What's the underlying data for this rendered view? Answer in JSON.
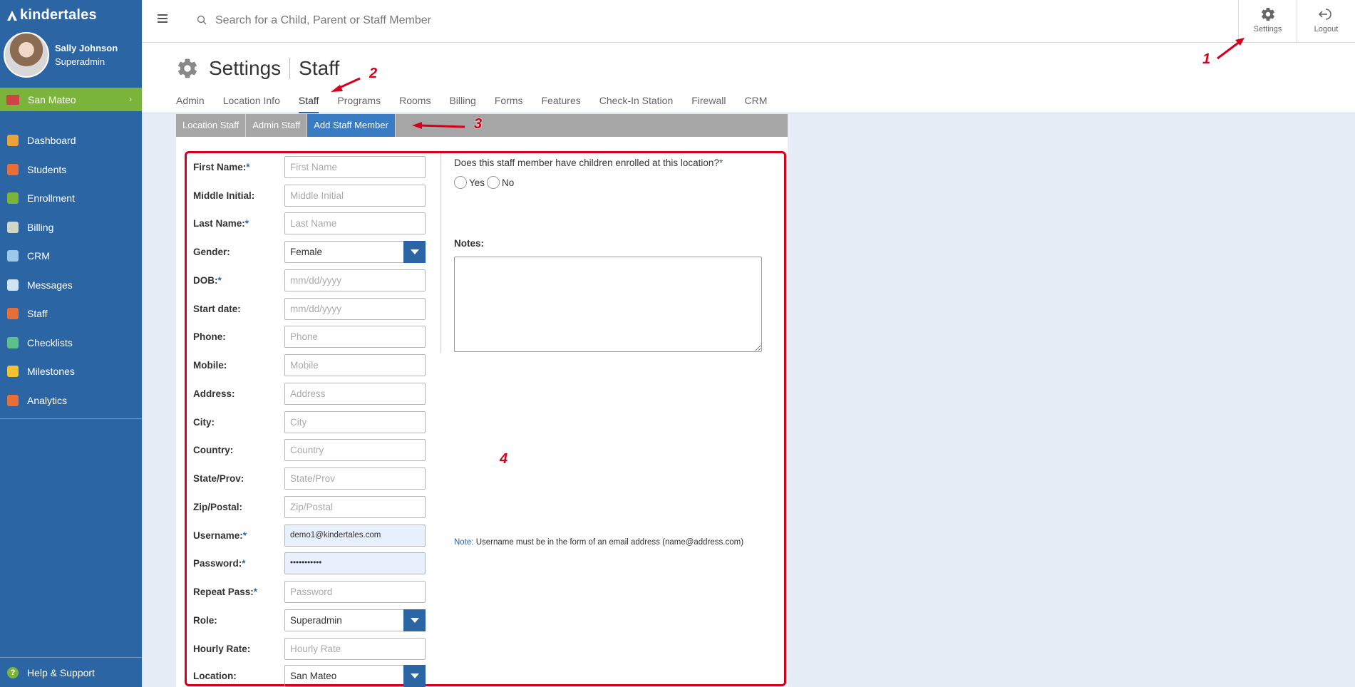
{
  "app": {
    "logo_text": "kindertales"
  },
  "profile": {
    "name": "Sally Johnson",
    "role": "Superadmin"
  },
  "location": {
    "name": "San Mateo"
  },
  "sidebar": {
    "items": [
      {
        "label": "Dashboard",
        "color": "#e8a33a"
      },
      {
        "label": "Students",
        "color": "#e76f3a"
      },
      {
        "label": "Enrollment",
        "color": "#7bb43a"
      },
      {
        "label": "Billing",
        "color": "#cfd8c4"
      },
      {
        "label": "CRM",
        "color": "#9cc8ea"
      },
      {
        "label": "Messages",
        "color": "#cfe3f5"
      },
      {
        "label": "Staff",
        "color": "#e76f3a"
      },
      {
        "label": "Checklists",
        "color": "#5fbf8a"
      },
      {
        "label": "Milestones",
        "color": "#f2c230"
      },
      {
        "label": "Analytics",
        "color": "#e76f3a"
      }
    ],
    "help_label": "Help & Support"
  },
  "topbar": {
    "search_placeholder": "Search for a Child, Parent or Staff Member",
    "settings_label": "Settings",
    "logout_label": "Logout"
  },
  "header": {
    "title": "Settings",
    "subtitle": "Staff"
  },
  "tabs": [
    "Admin",
    "Location Info",
    "Staff",
    "Programs",
    "Rooms",
    "Billing",
    "Forms",
    "Features",
    "Check-In Station",
    "Firewall",
    "CRM"
  ],
  "active_tab": "Staff",
  "subtabs": [
    "Location Staff",
    "Admin Staff",
    "Add Staff Member"
  ],
  "form": {
    "first_name": {
      "label": "First Name:",
      "placeholder": "First Name"
    },
    "middle_initial": {
      "label": "Middle Initial:",
      "placeholder": "Middle Initial"
    },
    "last_name": {
      "label": "Last Name:",
      "placeholder": "Last Name"
    },
    "gender": {
      "label": "Gender:",
      "value": "Female"
    },
    "dob": {
      "label": "DOB:",
      "placeholder": "mm/dd/yyyy"
    },
    "start_date": {
      "label": "Start date:",
      "placeholder": "mm/dd/yyyy"
    },
    "phone": {
      "label": "Phone:",
      "placeholder": "Phone"
    },
    "mobile": {
      "label": "Mobile:",
      "placeholder": "Mobile"
    },
    "address": {
      "label": "Address:",
      "placeholder": "Address"
    },
    "city": {
      "label": "City:",
      "placeholder": "City"
    },
    "country": {
      "label": "Country:",
      "placeholder": "Country"
    },
    "state": {
      "label": "State/Prov:",
      "placeholder": "State/Prov"
    },
    "zip": {
      "label": "Zip/Postal:",
      "placeholder": "Zip/Postal"
    },
    "username": {
      "label": "Username:",
      "value": "demo1@kindertales.com"
    },
    "password": {
      "label": "Password:",
      "value": "•••••••••••"
    },
    "repeat_pass": {
      "label": "Repeat Pass:",
      "placeholder": "Password"
    },
    "role": {
      "label": "Role:",
      "value": "Superadmin"
    },
    "hourly_rate": {
      "label": "Hourly Rate:",
      "placeholder": "Hourly Rate"
    },
    "location": {
      "label": "Location:",
      "value": "San Mateo"
    },
    "required_mark": "*",
    "children_question": "Does this staff member have children enrolled at this location?",
    "yes_label": "Yes",
    "no_label": "No",
    "notes_label": "Notes:",
    "note_keyword": "Note:",
    "note_text": " Username must be in the form of an email address (name@address.com)"
  },
  "annotations": [
    "1",
    "2",
    "3",
    "4"
  ],
  "colors": {
    "sidebar": "#2c65a3",
    "location_bar": "#7bb43a",
    "active_subtab": "#3a7cc4",
    "annotation": "#d6001c"
  }
}
